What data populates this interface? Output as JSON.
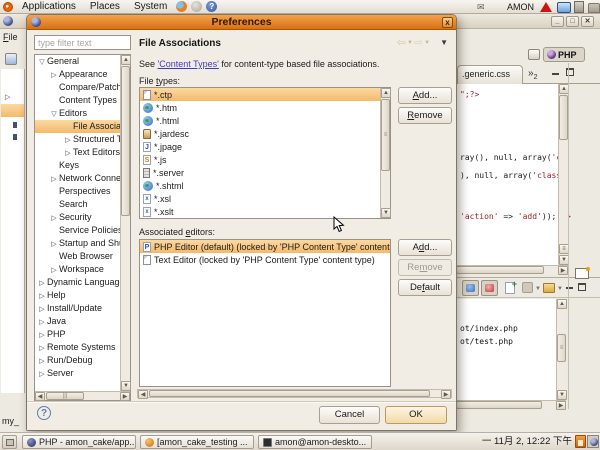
{
  "panel": {
    "menus": [
      "Applications",
      "Places",
      "System"
    ],
    "username": "AMON"
  },
  "dialog": {
    "title": "Preferences",
    "page_title": "File Associations",
    "description": {
      "prefix": "See ",
      "link": "'Content Types'",
      "suffix": " for content-type based file associations."
    },
    "filter_placeholder": "type filter text",
    "icons": {
      "close": "x",
      "help": "?"
    },
    "labels": {
      "file_types": {
        "pre": "File ",
        "m": "t",
        "post": "ypes:"
      },
      "associated_editors": {
        "pre": "Associated ",
        "m": "e",
        "post": "ditors:"
      }
    },
    "buttons": {
      "add_file_type": {
        "pre": "",
        "m": "A",
        "post": "dd..."
      },
      "remove_file_type": {
        "pre": "",
        "m": "R",
        "post": "emove"
      },
      "add_editor": {
        "pre": "A",
        "m": "d",
        "post": "d..."
      },
      "remove_editor": {
        "pre": "Re",
        "m": "m",
        "post": "ove"
      },
      "default": {
        "pre": "De",
        "m": "f",
        "post": "ault"
      },
      "cancel": "Cancel",
      "ok": "OK"
    },
    "tree": {
      "items": [
        {
          "arrow": "▽",
          "label": "General"
        },
        {
          "arrow": "▷",
          "label": "Appearance"
        },
        {
          "arrow": "",
          "label": "Compare/Patch"
        },
        {
          "arrow": "",
          "label": "Content Types"
        },
        {
          "arrow": "▽",
          "label": "Editors"
        },
        {
          "arrow": "",
          "label": "File Associations"
        },
        {
          "arrow": "▷",
          "label": "Structured Te"
        },
        {
          "arrow": "▷",
          "label": "Text Editors"
        },
        {
          "arrow": "",
          "label": "Keys"
        },
        {
          "arrow": "▷",
          "label": "Network Connec"
        },
        {
          "arrow": "",
          "label": "Perspectives"
        },
        {
          "arrow": "",
          "label": "Search"
        },
        {
          "arrow": "▷",
          "label": "Security"
        },
        {
          "arrow": "",
          "label": "Service Policies"
        },
        {
          "arrow": "▷",
          "label": "Startup and Shut"
        },
        {
          "arrow": "",
          "label": "Web Browser"
        },
        {
          "arrow": "▷",
          "label": "Workspace"
        },
        {
          "arrow": "▷",
          "label": "Dynamic Language"
        },
        {
          "arrow": "▷",
          "label": "Help"
        },
        {
          "arrow": "▷",
          "label": "Install/Update"
        },
        {
          "arrow": "▷",
          "label": "Java"
        },
        {
          "arrow": "▷",
          "label": "PHP"
        },
        {
          "arrow": "▷",
          "label": "Remote Systems"
        },
        {
          "arrow": "▷",
          "label": "Run/Debug"
        },
        {
          "arrow": "▷",
          "label": "Server"
        }
      ]
    },
    "file_types": [
      {
        "label": "*.ctp"
      },
      {
        "label": "*.htm"
      },
      {
        "label": "*.html"
      },
      {
        "label": "*.jardesc"
      },
      {
        "label": "*.jpage"
      },
      {
        "label": "*.js"
      },
      {
        "label": "*.server"
      },
      {
        "label": "*.shtml"
      },
      {
        "label": "*.xsl"
      },
      {
        "label": "*.xslt"
      }
    ],
    "associated_editors": [
      {
        "label": "PHP Editor (default) (locked by 'PHP Content Type' content t"
      },
      {
        "label": "Text Editor (locked by 'PHP Content Type' content type)"
      }
    ]
  },
  "eclipse": {
    "file_menu": {
      "m": "F",
      "post": "ile"
    },
    "my_label": "my_",
    "perspective_label": "PHP",
    "tab_label": ".generic.css",
    "tab_overflow_glyph": "»",
    "tab_overflow_count": "2",
    "code": {
      "l1": "\";?>",
      "l2a": "ray(), null, array(",
      "l2b": "'cl",
      "l3a": "), null, array(",
      "l3b": "'class'",
      "l4a": "'action'",
      "l4b": " => ",
      "l4c": "'add'",
      "l4d": ")); ",
      "l4e": "?>"
    },
    "console_lines": [
      "ot/index.php",
      "ot/test.php"
    ]
  },
  "taskbar": {
    "tasks": [
      {
        "label": "PHP - amon_cake/app..."
      },
      {
        "label": "[amon_cake_testing ..."
      },
      {
        "label": "amon@amon-deskto..."
      }
    ],
    "clock": "一 11月 2, 12:22 下午"
  }
}
